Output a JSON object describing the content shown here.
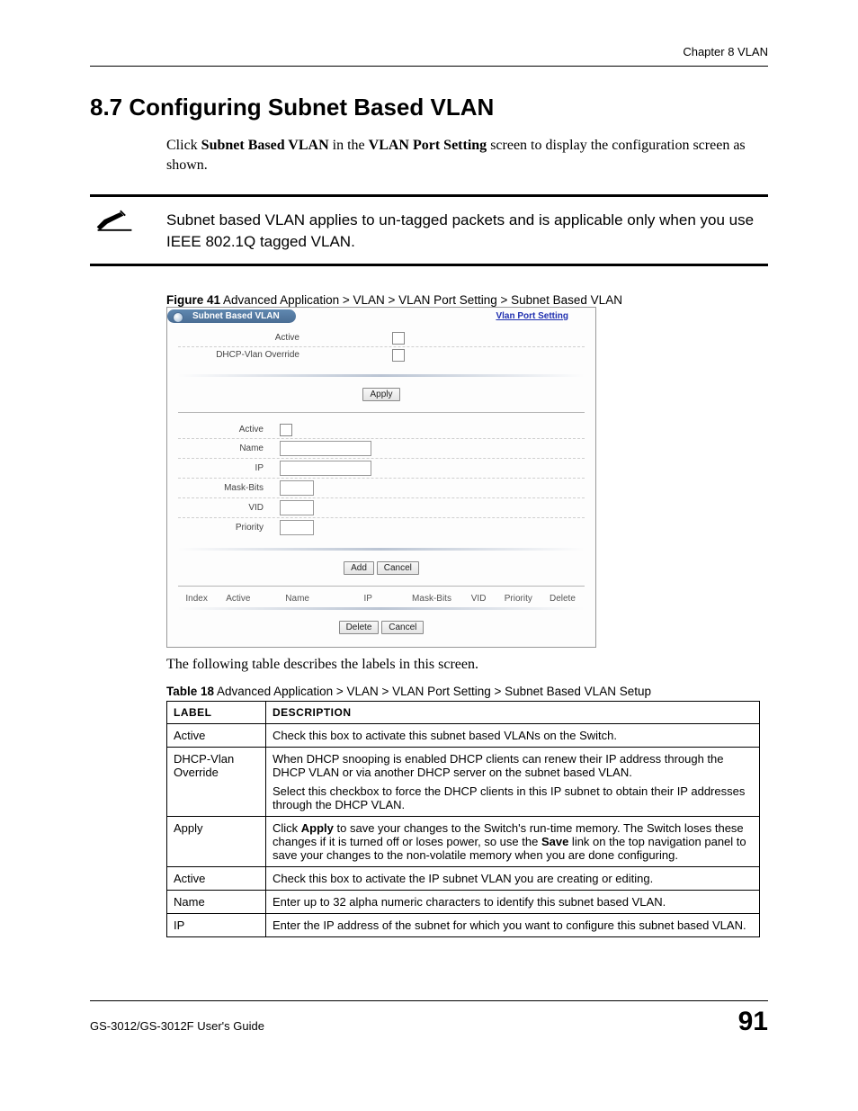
{
  "header": {
    "chapter_label": "Chapter 8 VLAN"
  },
  "section": {
    "heading": "8.7  Configuring Subnet Based VLAN",
    "intro_prefix": "Click ",
    "intro_b1": "Subnet Based VLAN",
    "intro_mid": " in the ",
    "intro_b2": "VLAN Port Setting",
    "intro_suffix": " screen to display the configuration screen as shown."
  },
  "note": {
    "text": "Subnet based VLAN applies to un-tagged packets and is applicable only when you use IEEE 802.1Q tagged VLAN."
  },
  "figure": {
    "label": "Figure 41",
    "caption": "   Advanced Application > VLAN > VLAN Port Setting > Subnet Based VLAN"
  },
  "screenshot": {
    "title_tab": "Subnet Based VLAN",
    "link": "Vlan Port Setting",
    "top": {
      "active_label": "Active",
      "dhcp_label": "DHCP-Vlan Override",
      "apply_btn": "Apply"
    },
    "form": {
      "active": "Active",
      "name": "Name",
      "ip": "IP",
      "maskbits": "Mask-Bits",
      "vid": "VID",
      "priority": "Priority",
      "add_btn": "Add",
      "cancel_btn": "Cancel"
    },
    "table_head": {
      "index": "Index",
      "active": "Active",
      "name": "Name",
      "ip": "IP",
      "maskbits": "Mask-Bits",
      "vid": "VID",
      "priority": "Priority",
      "delete": "Delete"
    },
    "bottom": {
      "delete_btn": "Delete",
      "cancel_btn": "Cancel"
    }
  },
  "after_figure_text": "The following table describes the labels in this screen.",
  "table_caption": {
    "label": "Table 18",
    "caption": "   Advanced Application > VLAN > VLAN Port Setting > Subnet Based VLAN Setup"
  },
  "table": {
    "headers": {
      "label": "Label",
      "description": "Description"
    },
    "rows": [
      {
        "label": "Active",
        "desc": [
          "Check this box to activate this subnet based VLANs on the Switch."
        ]
      },
      {
        "label": "DHCP-Vlan Override",
        "desc": [
          "When DHCP snooping is enabled DHCP clients can renew their IP address through the DHCP VLAN or via another DHCP server on the subnet based VLAN.",
          "Select this checkbox to force the DHCP clients in this IP subnet to obtain their IP addresses through the DHCP VLAN."
        ]
      },
      {
        "label": "Apply",
        "desc_parts": {
          "p1": "Click ",
          "b1": "Apply",
          "p2": " to save your changes to the Switch's run-time memory. The Switch loses these changes if it is turned off or loses power, so use the ",
          "b2": "Save",
          "p3": " link on the top navigation panel to save your changes to the non-volatile memory when you are done configuring."
        }
      },
      {
        "label": "Active",
        "desc": [
          "Check this box to activate the IP subnet VLAN you are creating or editing."
        ]
      },
      {
        "label": "Name",
        "desc": [
          "Enter up to 32 alpha numeric characters to identify this subnet based VLAN."
        ]
      },
      {
        "label": "IP",
        "desc": [
          "Enter the IP address of the subnet for which you want to configure this subnet based VLAN."
        ]
      }
    ]
  },
  "footer": {
    "guide": "GS-3012/GS-3012F User's Guide",
    "page": "91"
  }
}
